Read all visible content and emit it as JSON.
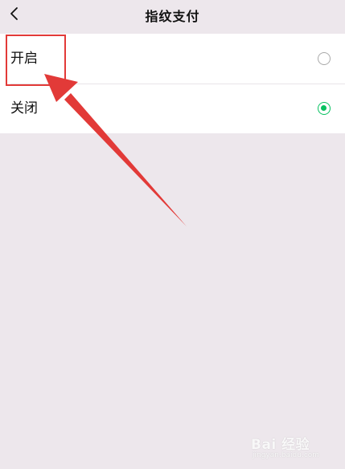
{
  "header": {
    "title": "指纹支付",
    "back_icon": "chevron-left-icon"
  },
  "options": [
    {
      "label": "开启",
      "selected": false
    },
    {
      "label": "关闭",
      "selected": true
    }
  ],
  "colors": {
    "background": "#ede7ec",
    "panel": "#ffffff",
    "radio_selected": "#07c160",
    "annotation_red": "#e23a38"
  },
  "watermark": {
    "logo": "Bai 经验",
    "url": "jingyan.baidu.com"
  }
}
